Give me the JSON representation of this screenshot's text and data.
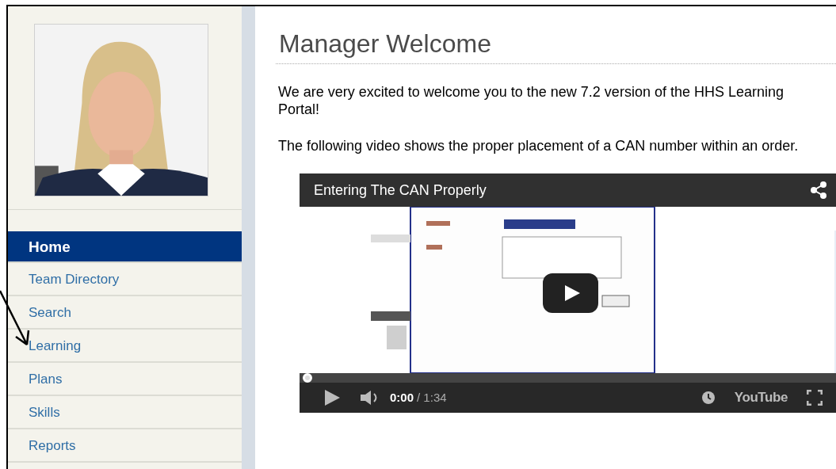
{
  "sidebar": {
    "nav": [
      {
        "label": "Home",
        "selected": true
      },
      {
        "label": "Team Directory",
        "selected": false
      },
      {
        "label": "Search",
        "selected": false
      },
      {
        "label": "Learning",
        "selected": false
      },
      {
        "label": "Plans",
        "selected": false
      },
      {
        "label": "Skills",
        "selected": false
      },
      {
        "label": "Reports",
        "selected": false
      }
    ]
  },
  "main": {
    "title": "Manager Welcome",
    "paragraphs": [
      "We are very excited to welcome you to the new 7.2 version of the HHS Learning Portal!",
      "The following video shows the proper placement of a CAN number within an order."
    ],
    "video": {
      "title": "Entering The CAN Properly",
      "elapsed": "0:00",
      "duration": "/ 1:34",
      "logo": "YouTube",
      "progress": {
        "level": 0
      }
    }
  }
}
